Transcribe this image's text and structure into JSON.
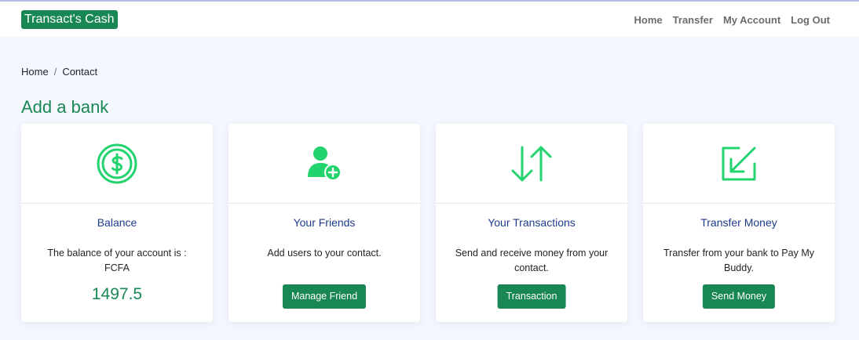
{
  "brand": "Transact's Cash",
  "nav": [
    "Home",
    "Transfer",
    "My Account",
    "Log Out"
  ],
  "breadcrumb": {
    "home": "Home",
    "separator": "/",
    "current": "Contact"
  },
  "page_title": "Add a bank",
  "accent_color": "#198754",
  "icon_color": "#22d36e",
  "cards": [
    {
      "icon": "dollar-circle-icon",
      "title": "Balance",
      "text": "The balance of your account is : FCFA",
      "value": "1497.5"
    },
    {
      "icon": "add-user-icon",
      "title": "Your Friends",
      "text": "Add users to your contact.",
      "button": "Manage Friend"
    },
    {
      "icon": "arrows-up-down-icon",
      "title": "Your Transactions",
      "text": "Send and receive money from your contact.",
      "button": "Transaction"
    },
    {
      "icon": "arrow-down-left-box-icon",
      "title": "Transfer Money",
      "text": "Transfer from your bank to Pay My Buddy.",
      "button": "Send Money"
    }
  ]
}
